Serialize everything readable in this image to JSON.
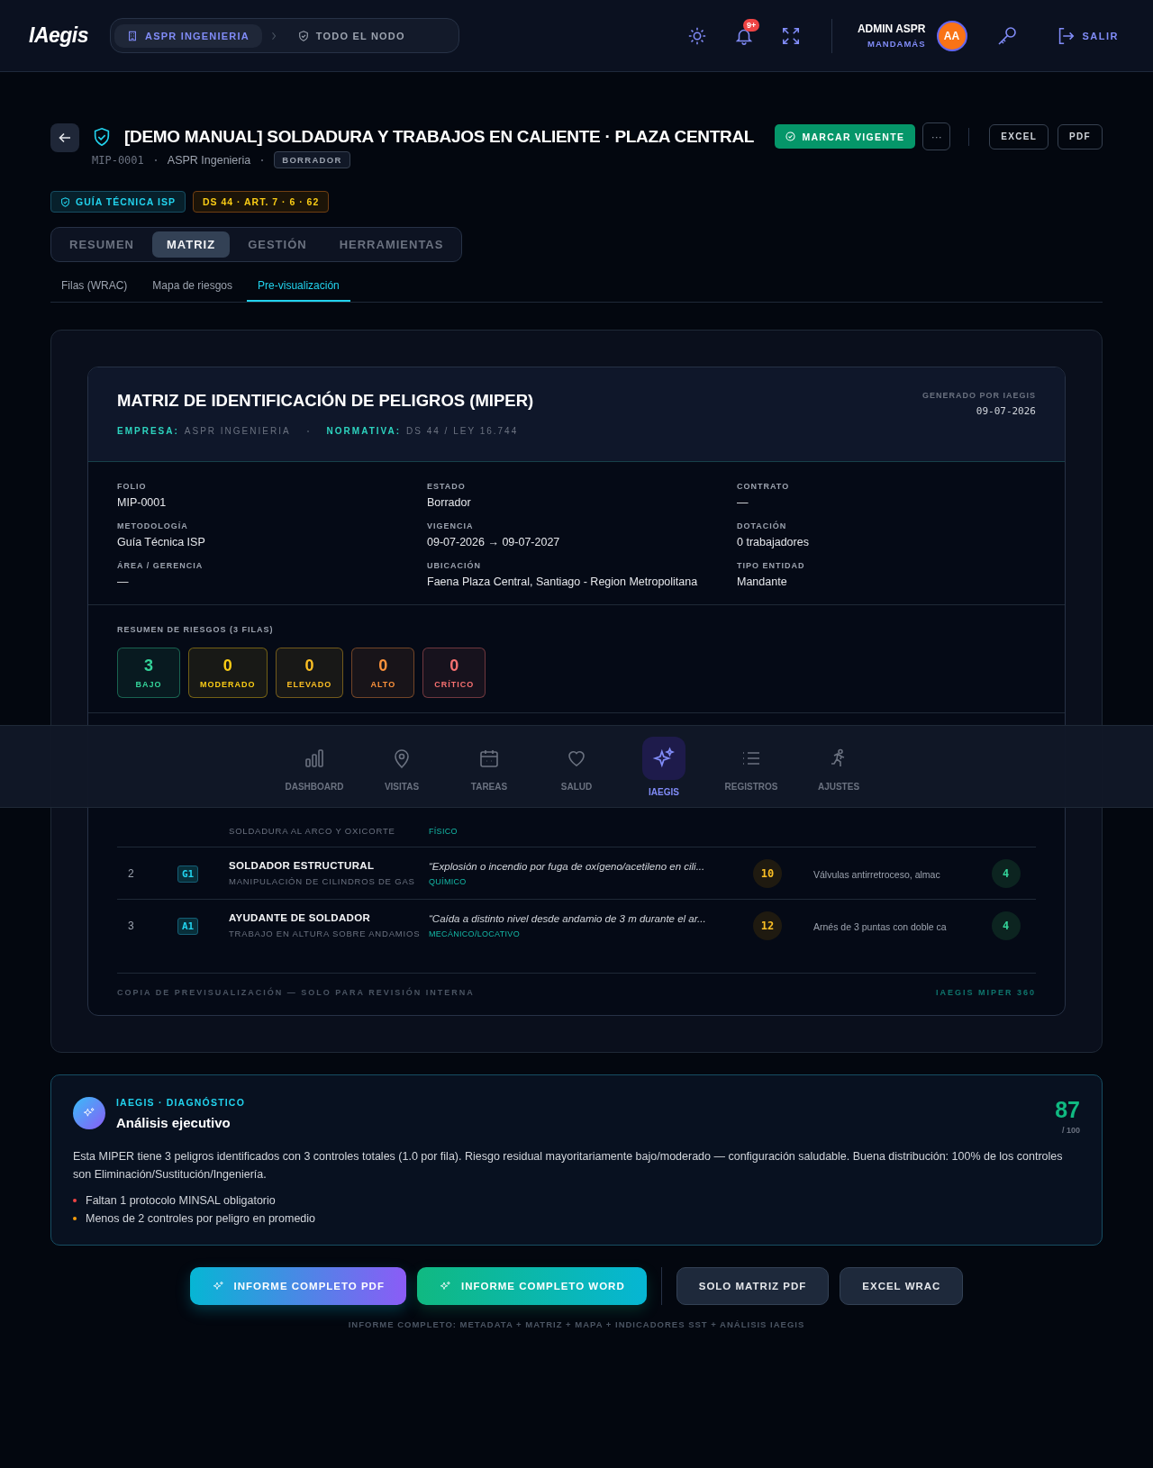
{
  "header": {
    "logo": "IAegis",
    "breadcrumb": [
      {
        "label": "ASPR INGENIERIA",
        "selected": true
      },
      {
        "label": "TODO EL NODO",
        "selected": false
      }
    ],
    "notification_badge": "9+",
    "user": {
      "name": "ADMIN ASPR",
      "role": "MANDAMÁS",
      "initials": "AA"
    },
    "logout": "SALIR"
  },
  "document": {
    "title": "[DEMO MANUAL] SOLDADURA Y TRABAJOS EN CALIENTE · PLAZA CENTRAL",
    "code": "MIP-0001",
    "company": "ASPR Ingenieria",
    "status": "BORRADOR",
    "primary_action": "MARCAR VIGENTE",
    "more": "···",
    "exports": [
      "EXCEL",
      "PDF"
    ],
    "tags": [
      {
        "label": "GUÍA TÉCNICA ISP",
        "kind": "method"
      },
      {
        "label": "DS 44 · ART. 7 · 6 · 62",
        "kind": "norm"
      }
    ]
  },
  "tabs": [
    {
      "label": "RESUMEN",
      "selected": false
    },
    {
      "label": "MATRIZ",
      "selected": true
    },
    {
      "label": "GESTIÓN",
      "selected": false
    },
    {
      "label": "HERRAMIENTAS",
      "selected": false
    }
  ],
  "subtabs": [
    {
      "label": "Filas (WRAC)",
      "selected": false
    },
    {
      "label": "Mapa de riesgos",
      "selected": false
    },
    {
      "label": "Pre-visualización",
      "selected": true
    }
  ],
  "preview": {
    "title": "MATRIZ DE IDENTIFICACIÓN DE PELIGROS (MIPER)",
    "meta": [
      {
        "label": "EMPRESA:",
        "value": "ASPR INGENIERIA"
      },
      {
        "label": "NORMATIVA:",
        "value": "DS 44 / LEY 16.744"
      }
    ],
    "generated_label": "GENERADO POR IAEGIS",
    "generated_date": "09-07-2026",
    "fields": [
      {
        "label": "FOLIO",
        "value": "MIP-0001"
      },
      {
        "label": "ESTADO",
        "value": "Borrador"
      },
      {
        "label": "CONTRATO",
        "value": "—"
      },
      {
        "label": "METODOLOGÍA",
        "value": "Guía Técnica ISP"
      },
      {
        "label": "VIGENCIA",
        "value": "09-07-2026 → 09-07-2027"
      },
      {
        "label": "DOTACIÓN",
        "value": "0 trabajadores"
      },
      {
        "label": "ÁREA / GERENCIA",
        "value": "—"
      },
      {
        "label": "UBICACIÓN",
        "value": "Faena Plaza Central, Santiago - Region Metropolitana"
      },
      {
        "label": "TIPO ENTIDAD",
        "value": "Mandante"
      }
    ],
    "summary_title": "RESUMEN DE RIESGOS (3 FILAS)",
    "summary": [
      {
        "count": "3",
        "label": "BAJO",
        "color": "#34d399"
      },
      {
        "count": "0",
        "label": "MODERADO",
        "color": "#facc15"
      },
      {
        "count": "0",
        "label": "ELEVADO",
        "color": "#fbbf24"
      },
      {
        "count": "0",
        "label": "ALTO",
        "color": "#fb923c"
      },
      {
        "count": "0",
        "label": "CRÍTICO",
        "color": "#f87171"
      }
    ],
    "rows": [
      {
        "sub": "SOLDADURA AL ARCO Y OXICORTE",
        "category": "FÍSICO"
      },
      {
        "number": "2",
        "code": "G1",
        "role": "SOLDADOR ESTRUCTURAL",
        "sub": "MANIPULACIÓN DE CILINDROS DE GAS",
        "hazard": "“Explosión o incendio por fuga de oxígeno/acetileno en cili...",
        "category": "QUÍMICO",
        "initial": "10",
        "control": "Válvulas antirretroceso, almac",
        "residual": "4"
      },
      {
        "number": "3",
        "code": "A1",
        "role": "AYUDANTE DE SOLDADOR",
        "sub": "TRABAJO EN ALTURA SOBRE ANDAMIOS",
        "hazard": "“Caída a distinto nivel desde andamio de 3 m durante el ar...",
        "category": "MECÁNICO/LOCATIVO",
        "initial": "12",
        "control": "Arnés de 3 puntas con doble ca",
        "residual": "4"
      }
    ],
    "footer_left": "COPIA DE PREVISUALIZACIÓN — SOLO PARA REVISIÓN INTERNA",
    "footer_right": "IAEGIS MIPER 360"
  },
  "analysis": {
    "eyebrow": "IAEGIS · DIAGNÓSTICO",
    "title": "Análisis ejecutivo",
    "score": "87",
    "score_max": "/ 100",
    "text": "Esta MIPER tiene 3 peligros identificados con 3 controles totales (1.0 por fila). Riesgo residual mayoritariamente bajo/moderado — configuración saludable. Buena distribución: 100% de los controles son Eliminación/Sustitución/Ingeniería.",
    "findings": [
      {
        "text": "Faltan 1 protocolo MINSAL obligatorio",
        "color": "#ef4444"
      },
      {
        "text": "Menos de 2 controles por peligro en promedio",
        "color": "#f59e0b"
      }
    ]
  },
  "actions": [
    {
      "label": "INFORME COMPLETO PDF",
      "kind": "ai_violet"
    },
    {
      "label": "INFORME COMPLETO WORD",
      "kind": "ai_teal"
    },
    {
      "label": "SOLO MATRIZ PDF",
      "kind": "plain"
    },
    {
      "label": "EXCEL WRAC",
      "kind": "plain"
    }
  ],
  "actions_note": "INFORME COMPLETO: METADATA + MATRIZ + MAPA + INDICADORES SST + ANÁLISIS IAEGIS",
  "bottom_nav": [
    {
      "label": "DASHBOARD",
      "selected": false
    },
    {
      "label": "VISITAS",
      "selected": false
    },
    {
      "label": "TAREAS",
      "selected": false
    },
    {
      "label": "SALUD",
      "selected": false
    },
    {
      "label": "IAEGIS",
      "selected": true
    },
    {
      "label": "REGISTROS",
      "selected": false
    },
    {
      "label": "AJUSTES",
      "selected": false
    }
  ]
}
